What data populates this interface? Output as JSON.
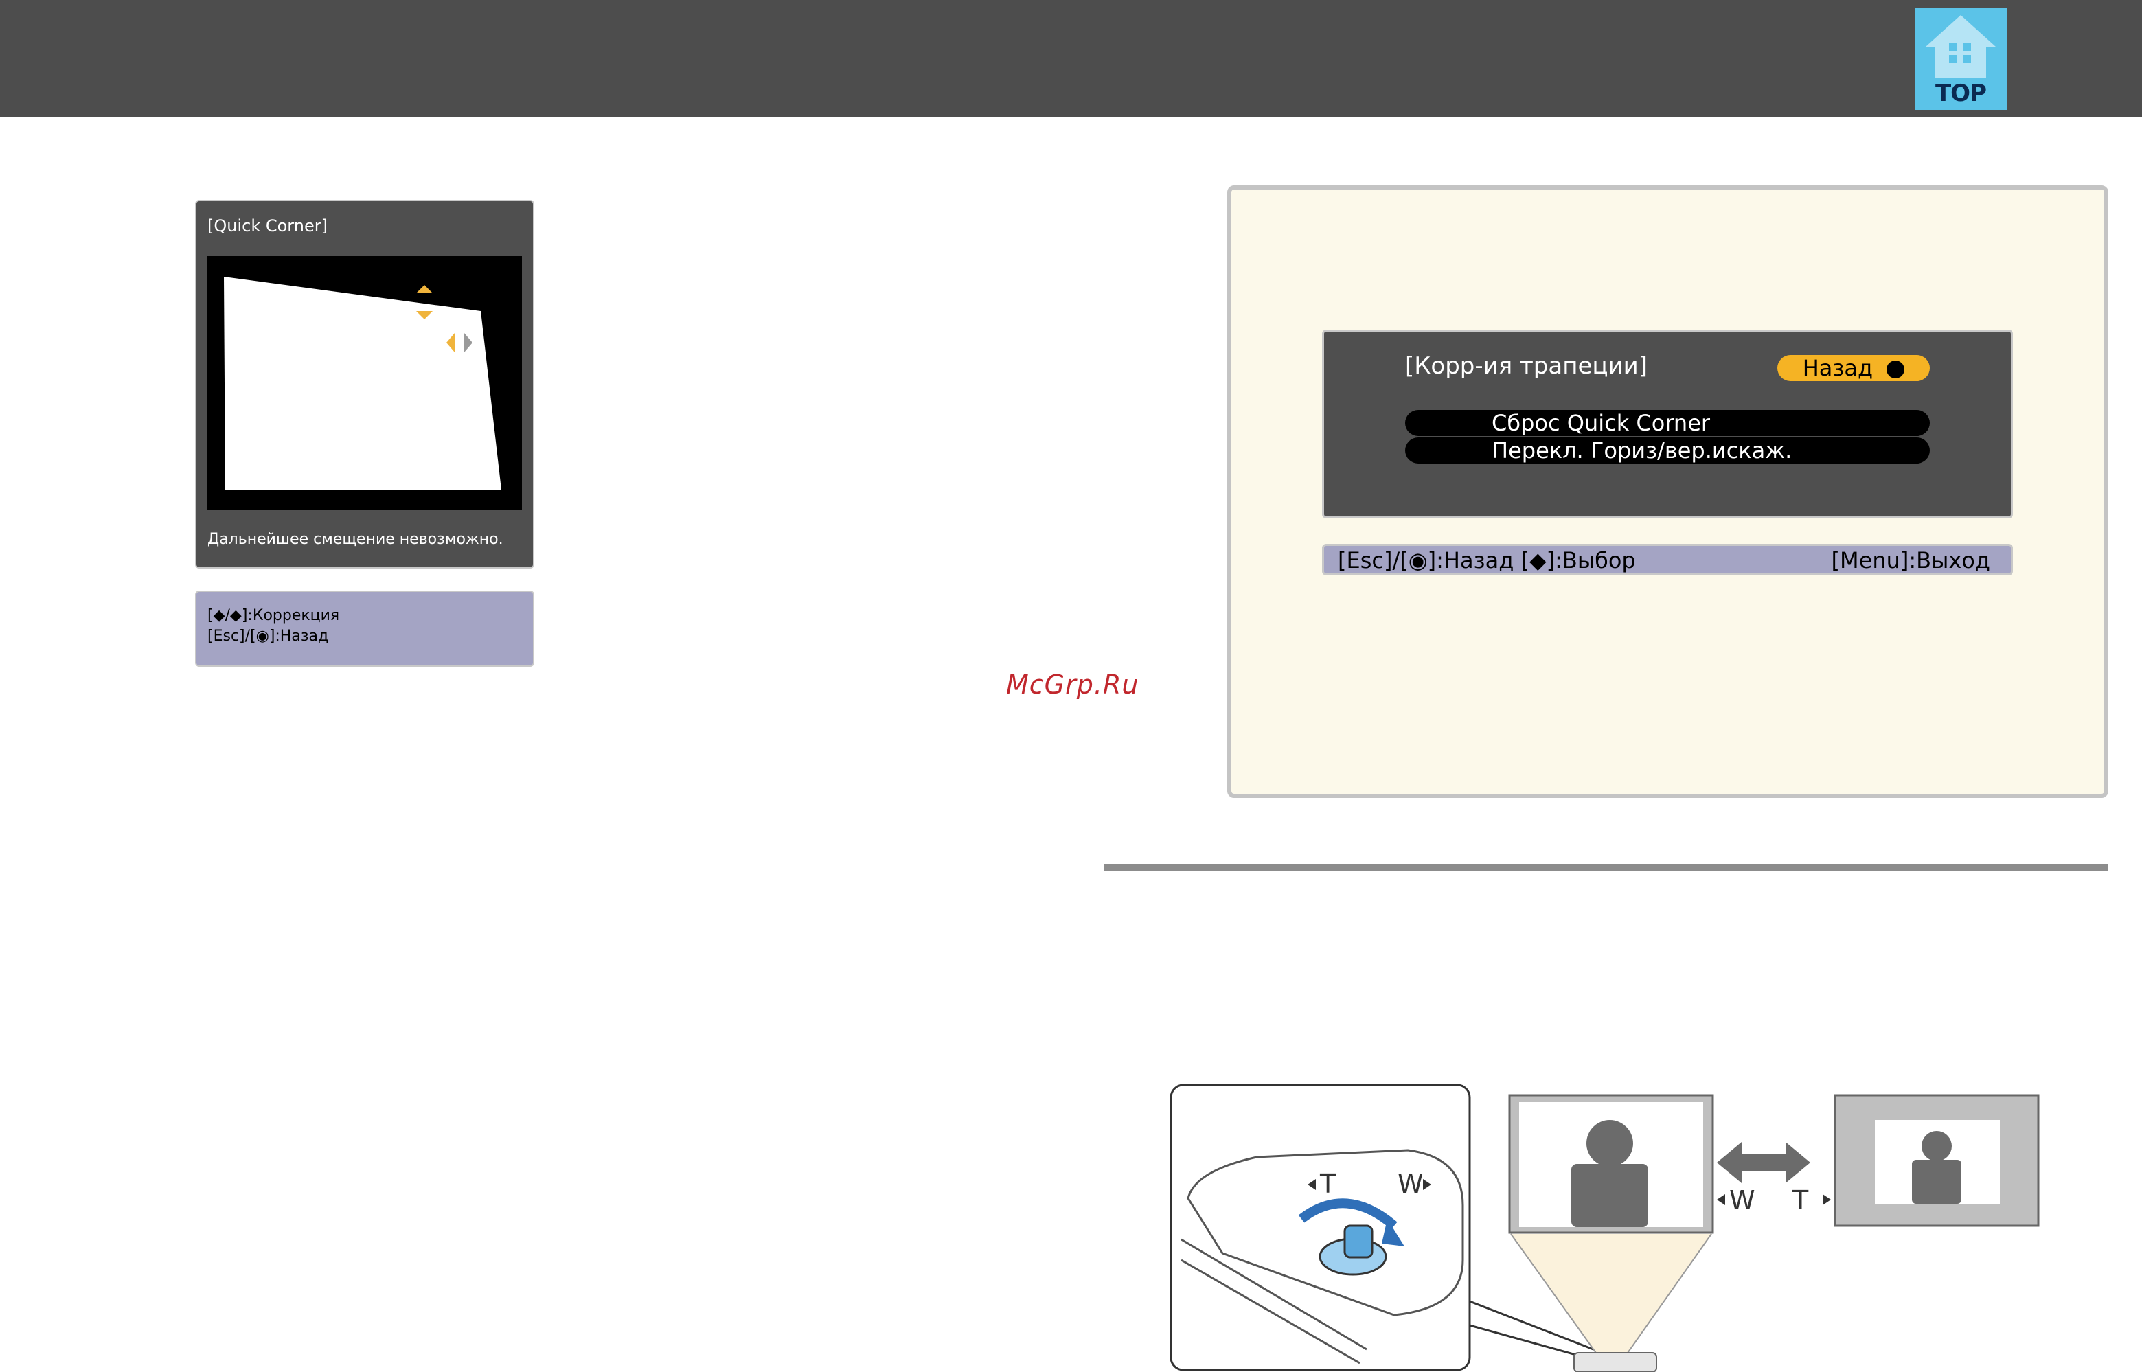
{
  "header": {
    "top_button_label": "TOP",
    "bar_color": "#4d4d4d"
  },
  "quick_corner_panel": {
    "title": "[Quick Corner]",
    "message": "Дальнейшее смещение невозможно.",
    "arrow_color": "#f0b43c"
  },
  "quick_corner_help": {
    "line1": "[◆/◆]:Коррекция",
    "line2": "[Esc]/[◉]:Назад"
  },
  "watermark": "McGrp.Ru",
  "keystone_menu": {
    "title": "[Корр-ия трапеции]",
    "back_button": "Назад",
    "items": [
      "Сброс Quick Corner",
      "Перекл. Гориз/вер.искаж."
    ],
    "help_left": "[Esc]/[◉]:Назад  [◆]:Выбор",
    "help_right": "[Menu]:Выход"
  },
  "zoom_illustration": {
    "ring_label_t": "T",
    "ring_label_w": "W",
    "result_label_w": "W",
    "result_label_t": "T",
    "accent_color": "#5aa7dc"
  }
}
